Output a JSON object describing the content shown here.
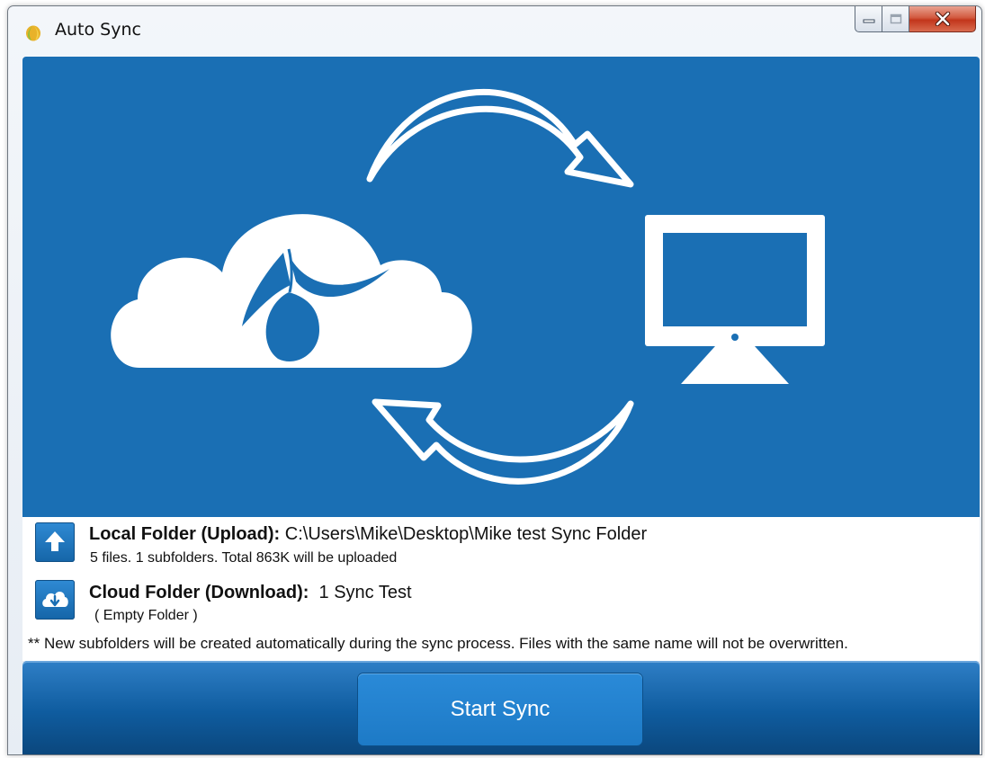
{
  "window": {
    "title": "Auto Sync",
    "controls": [
      "minimize-icon",
      "maximize-icon",
      "close-icon"
    ]
  },
  "hero": {
    "icons": [
      "cloud-icon",
      "monitor-icon",
      "sync-arrow-top-icon",
      "sync-arrow-bottom-icon"
    ],
    "background_color": "#1a6fb4"
  },
  "local_folder": {
    "label": "Local Folder (Upload):",
    "path": " C:\\Users\\Mike\\Desktop\\Mike test Sync Folder",
    "summary": "5 files. 1 subfolders. Total 863K will be uploaded",
    "icon": "upload-icon"
  },
  "cloud_folder": {
    "label": "Cloud Folder (Download):",
    "name": "  1 Sync Test",
    "summary": "( Empty Folder )",
    "icon": "cloud-download-icon"
  },
  "note": "** New subfolders will be created automatically during the sync process. Files with the same name will not be overwritten.",
  "footer": {
    "start_button_label": "Start Sync"
  }
}
